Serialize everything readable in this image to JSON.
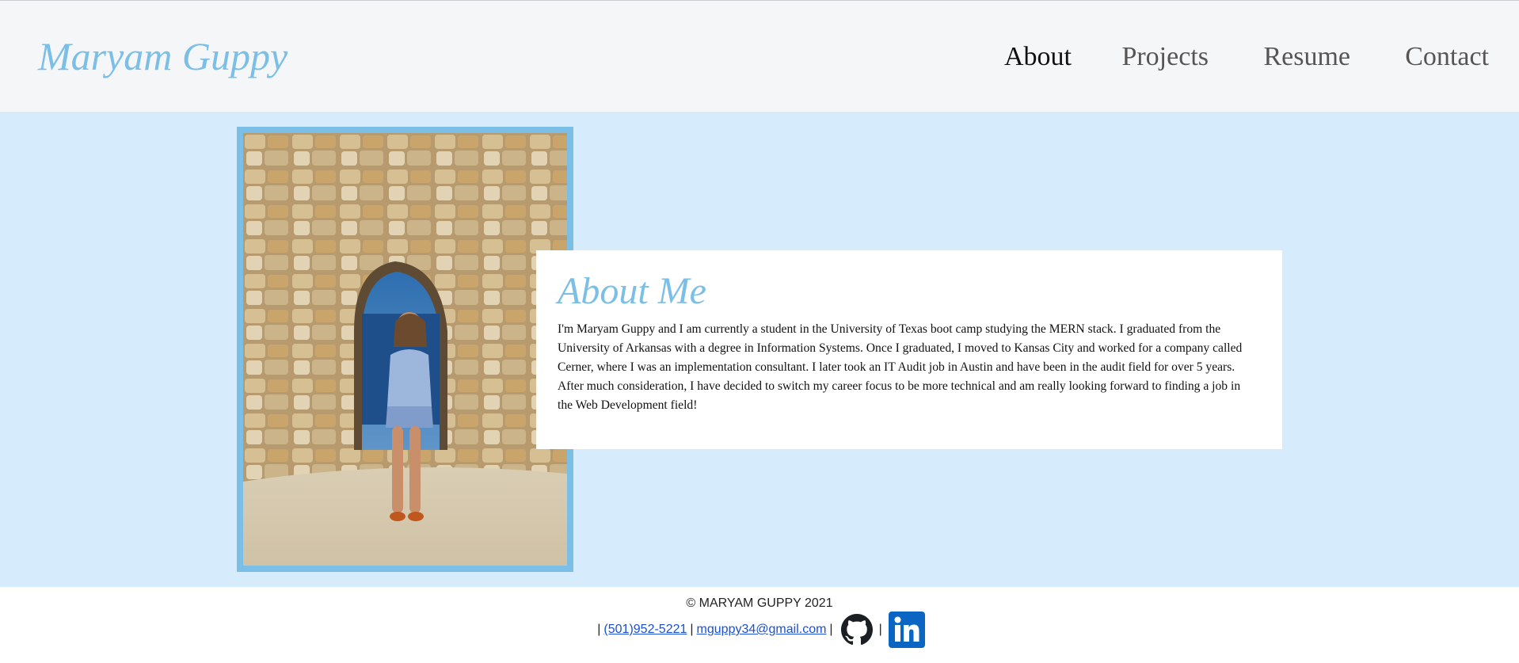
{
  "header": {
    "brand": "Maryam Guppy",
    "nav": [
      {
        "label": "About",
        "active": true
      },
      {
        "label": "Projects",
        "active": false
      },
      {
        "label": "Resume",
        "active": false
      },
      {
        "label": "Contact",
        "active": false
      }
    ]
  },
  "about": {
    "title": "About Me",
    "body": "I'm Maryam Guppy and I am currently a student in the University of Texas boot camp studying the MERN stack. I graduated from the University of Arkansas with a degree in Information Systems. Once I graduated, I moved to Kansas City and worked for a company called Cerner, where I was an implementation consultant. I later took an IT Audit job in Austin and have been in the audit field for over 5 years. After much consideration, I have decided to switch my career focus to be more technical and am really looking forward to finding a job in the Web Development field!"
  },
  "footer": {
    "copyright": "© MARYAM GUPPY   2021",
    "separator": "|",
    "phone": "(501)952-5221 ",
    "email": "mguppy34@gmail.com ",
    "icons": [
      "github-icon",
      "linkedin-icon"
    ]
  },
  "colors": {
    "accent": "#7cbfe6",
    "header_bg": "#f5f6f8",
    "main_bg": "#d6ebfb",
    "link": "#1a4fd6",
    "linkedin": "#0a66c2"
  }
}
